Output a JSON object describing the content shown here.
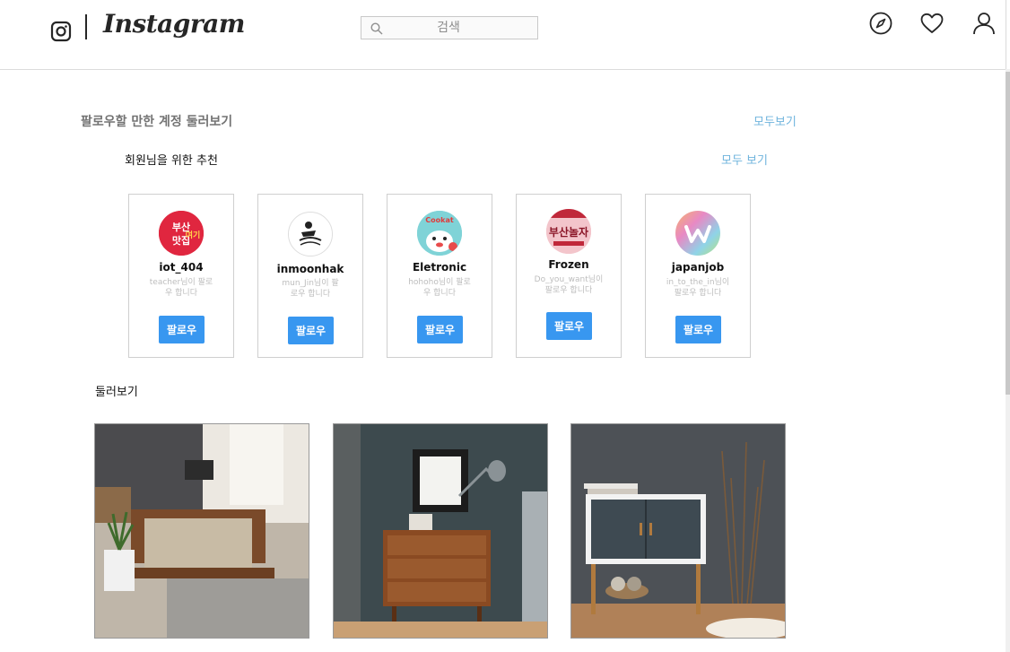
{
  "header": {
    "brand": "Instagram",
    "search_placeholder": "검색"
  },
  "suggest": {
    "title": "팔로우할 만한 계정 둘러보기",
    "see_all": "모두보기",
    "subtitle": "회원님을 위한 추천",
    "see_all_2": "모두 보기"
  },
  "cards": [
    {
      "username": "iot_404",
      "line1": "teacher님이 팔로",
      "line2": "우 합니다",
      "button": "팔로우"
    },
    {
      "username": "inmoonhak",
      "line1": "mun_Jin님이 팔",
      "line2": "로우 합니다",
      "button": "팔로우"
    },
    {
      "username": "Eletronic",
      "line1": "hohoho님이 팔로",
      "line2": "우 합니다",
      "button": "팔로우"
    },
    {
      "username": "Frozen",
      "line1": "Do_you_want님이",
      "line2": "팔로우 합니다",
      "button": "팔로우"
    },
    {
      "username": "japanjob",
      "line1": "in_to_the_in님이",
      "line2": "팔로우 합니다",
      "button": "팔로우"
    }
  ],
  "avatar_text": {
    "a1": "부산맛집여기",
    "a3": "Cookat",
    "a4": "부산놀자"
  },
  "explore": {
    "title": "둘러보기"
  },
  "icons": [
    "instagram-glyph-icon",
    "search-icon",
    "compass-icon",
    "heart-icon",
    "user-icon"
  ],
  "colors": {
    "accent": "#3897f0",
    "link": "#6fb4dd"
  }
}
